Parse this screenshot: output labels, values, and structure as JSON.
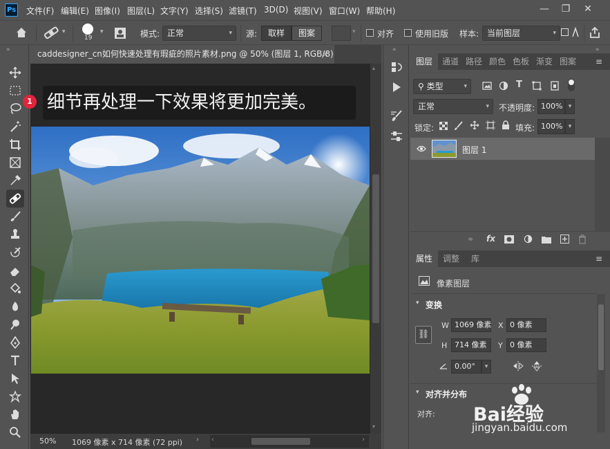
{
  "menubar": {
    "logo": "Ps",
    "items": [
      "文件(F)",
      "编辑(E)",
      "图像(I)",
      "图层(L)",
      "文字(Y)",
      "选择(S)",
      "滤镜(T)",
      "3D(D)",
      "视图(V)",
      "窗口(W)",
      "帮助(H)"
    ],
    "window_buttons": [
      "—",
      "❐",
      "✕"
    ]
  },
  "options": {
    "brush_size": "19",
    "mode_label": "模式:",
    "mode_value": "正常",
    "source_label": "源:",
    "sample_btn": "取样",
    "pattern_btn": "图案",
    "align_label": "对齐",
    "legacy_label": "使用旧版",
    "sample_label": "样本:",
    "sample_value": "当前图层"
  },
  "document": {
    "tab_title": "caddesigner_cn如何快速处理有瑕疵的照片素材.png @ 50% (图层 1, RGB/8) *",
    "tab_close": "×",
    "banner_text": "细节再处理一下效果将更加完美。",
    "badge": "1",
    "zoom": "50%",
    "doc_info": "1069 像素 x 714 像素 (72 ppi)"
  },
  "layers_panel": {
    "tabs": [
      "图层",
      "通道",
      "路径",
      "颜色",
      "色板",
      "渐变",
      "图案"
    ],
    "filter_kind": "类型",
    "blend_mode": "正常",
    "opacity_label": "不透明度:",
    "opacity_value": "100%",
    "lock_label": "锁定:",
    "fill_label": "填充:",
    "fill_value": "100%",
    "layer_name": "图层 1"
  },
  "properties_panel": {
    "tabs": [
      "属性",
      "调整",
      "库"
    ],
    "type_label": "像素图层",
    "transform_heading": "变换",
    "w_label": "W",
    "w_value": "1069 像素",
    "h_label": "H",
    "h_value": "714 像素",
    "x_label": "X",
    "x_value": "0 像素",
    "y_label": "Y",
    "y_value": "0 像素",
    "angle_value": "0.00°",
    "align_heading": "对齐并分布",
    "align_label": "对齐:"
  },
  "watermark": {
    "brand": "Bai经验",
    "url": "jingyan.baidu.com"
  }
}
